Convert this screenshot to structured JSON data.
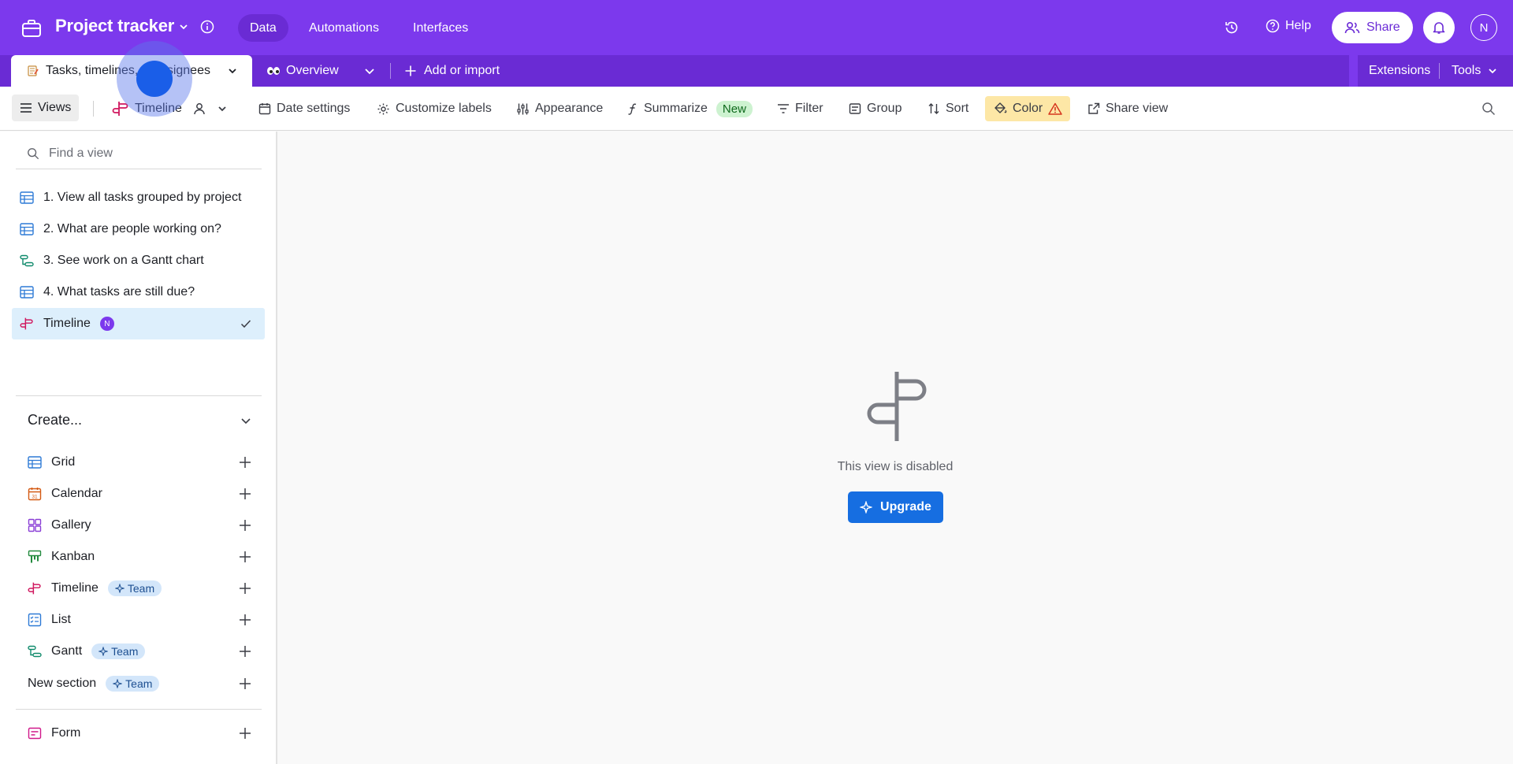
{
  "header": {
    "app_title": "Project tracker",
    "nav": [
      "Data",
      "Automations",
      "Interfaces"
    ],
    "help_label": "Help",
    "share_label": "Share",
    "user_initial": "N"
  },
  "tabs": {
    "active_tab": "Tasks, timelines, & assignees",
    "overview_label": "Overview",
    "add_label": "Add or import",
    "extensions_label": "Extensions",
    "tools_label": "Tools"
  },
  "toolbar": {
    "views_label": "Views",
    "current_view": "Timeline",
    "date_settings": "Date settings",
    "customize_labels": "Customize labels",
    "appearance": "Appearance",
    "summarize": "Summarize",
    "new_badge": "New",
    "filter": "Filter",
    "group": "Group",
    "sort": "Sort",
    "color": "Color",
    "share_view": "Share view"
  },
  "sidebar": {
    "search_placeholder": "Find a view",
    "views": [
      {
        "label": "1. View all tasks grouped by project",
        "icon": "grid-icon"
      },
      {
        "label": "2. What are people working on?",
        "icon": "grid-icon"
      },
      {
        "label": "3. See work on a Gantt chart",
        "icon": "gantt-icon"
      },
      {
        "label": "4. What tasks are still due?",
        "icon": "grid-icon"
      },
      {
        "label": "Timeline",
        "icon": "timeline-icon",
        "badge": "N",
        "selected": true
      }
    ],
    "create_heading": "Create...",
    "create_items": [
      {
        "label": "Grid",
        "icon": "grid-icon"
      },
      {
        "label": "Calendar",
        "icon": "calendar-icon"
      },
      {
        "label": "Gallery",
        "icon": "gallery-icon"
      },
      {
        "label": "Kanban",
        "icon": "kanban-icon"
      },
      {
        "label": "Timeline",
        "icon": "timeline-icon",
        "badge": "Team"
      },
      {
        "label": "List",
        "icon": "list-icon"
      },
      {
        "label": "Gantt",
        "icon": "gantt-icon",
        "badge": "Team"
      },
      {
        "label": "New section",
        "badge": "Team"
      },
      {
        "label": "Form",
        "icon": "form-icon"
      }
    ]
  },
  "main": {
    "empty_message": "This view is disabled",
    "upgrade_label": "Upgrade"
  },
  "colors": {
    "header_bg": "#7c39ed",
    "tab_strip_bg": "#6a2bd4",
    "primary_button": "#166ee1",
    "selected_view_bg": "#ddeffc",
    "color_button_bg": "#fde7a6"
  }
}
